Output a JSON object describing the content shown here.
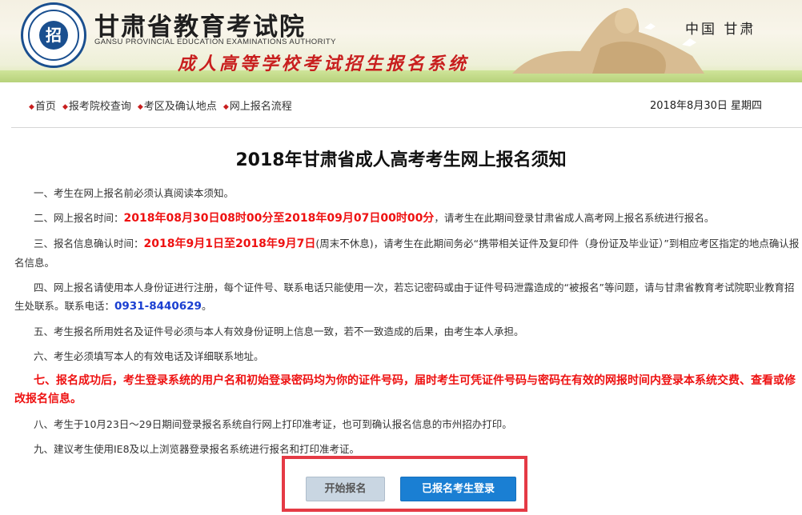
{
  "header": {
    "org_name": "甘肃省教育考试院",
    "org_name_en": "GANSU PROVINCIAL EDUCATION EXAMINATIONS AUTHORITY",
    "system_name": "成人高等学校考试招生报名系统",
    "region": "中国 甘肃",
    "logo_char": "招"
  },
  "nav": {
    "items": [
      {
        "label": "首页"
      },
      {
        "label": "报考院校查询"
      },
      {
        "label": "考区及确认地点"
      },
      {
        "label": "网上报名流程"
      }
    ],
    "date": "2018年8月30日 星期四"
  },
  "notice": {
    "title": "2018年甘肃省成人高考考生网上报名须知",
    "item1": "一、考生在网上报名前必须认真阅读本须知。",
    "item2_pre": "二、网上报名时间：",
    "item2_time": "2018年08月30日08时00分至2018年09月07日00时00分",
    "item2_post": "，请考生在此期间登录甘肃省成人高考网上报名系统进行报名。",
    "item3_pre": "三、报名信息确认时间：",
    "item3_time": "2018年9月1日至2018年9月7日",
    "item3_post": "(周末不休息)，请考生在此期间务必“携带相关证件及复印件（身份证及毕业证）”到相应考区指定的地点确认报名信息。",
    "item4_pre": "四、网上报名请使用本人身份证进行注册，每个证件号、联系电话只能使用一次，若忘记密码或由于证件号码泄露造成的“被报名”等问题，请与甘肃省教育考试院职业教育招生处联系。联系电话：",
    "item4_phone": "0931-8440629",
    "item4_post": "。",
    "item5": "五、考生报名所用姓名及证件号必须与本人有效身份证明上信息一致，若不一致造成的后果，由考生本人承担。",
    "item6": "六、考生必须填写本人的有效电话及详细联系地址。",
    "item7": "七、报名成功后，考生登录系统的用户名和初始登录密码均为你的证件号码，届时考生可凭证件号码与密码在有效的网报时间内登录本系统交费、查看或修改报名信息。",
    "item8": "八、考生于10月23日～29日期间登录报名系统自行网上打印准考证，也可到确认报名信息的市州招办打印。",
    "item9": "九、建议考生使用IE8及以上浏览器登录报名系统进行报名和打印准考证。"
  },
  "buttons": {
    "start": "开始报名",
    "login": "已报名考生登录"
  },
  "colors": {
    "accent_red": "#e11111",
    "phone_blue": "#1a3fd1",
    "login_blue": "#1a7fd3",
    "highlight_box": "#e53a45"
  }
}
